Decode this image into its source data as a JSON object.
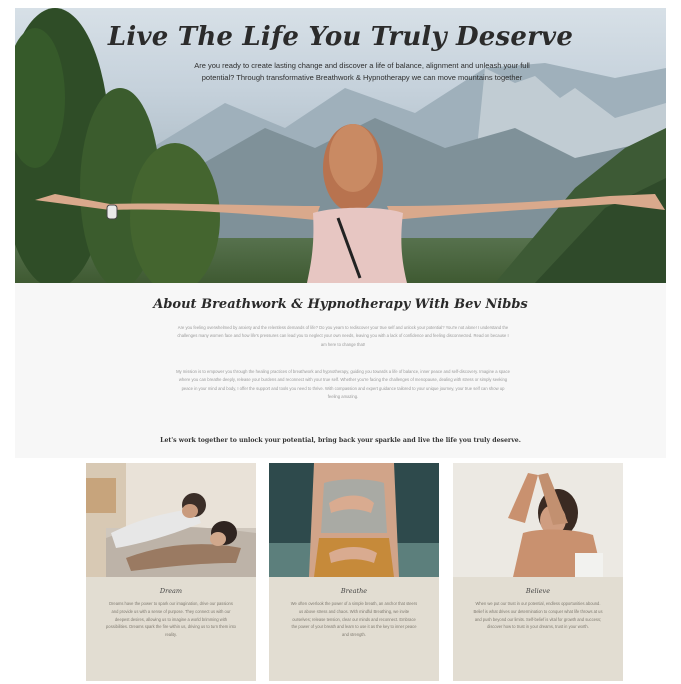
{
  "hero": {
    "title": "Live The Life You Truly Deserve",
    "subtitle": "Are you ready to create lasting change and discover a life of balance, alignment and unleash your full potential? Through transformative Breathwork & Hypnotherapy we can move mountains together"
  },
  "about": {
    "title": "About Breathwork & Hypnotherapy With Bev Nibbs",
    "paragraph1": "Are you feeling overwhelmed by anxiety and the relentless demands of life? Do you yearn to rediscover your true self and unlock your potential? You're not alone! I understand the challenges many women face and how life's pressures can lead you to neglect your own needs, leaving you with a lack of confidence and feeling disconnected. Read on because I am here to change that!",
    "paragraph2": "My mission is to empower you through the healing practices of breathwork and hypnotherapy, guiding you towards a life of balance, inner peace and self-discovery. Imagine a space where you can breathe deeply, release your burdens and reconnect with your true self. Whether you're facing the challenges of menopause, dealing with stress or simply seeking peace in your mind and body, I offer the support and tools you need to thrive. With compassion and expert guidance tailored to your unique journey, your true self can show up feeling amazing.",
    "cta": "Let's work together to unlock your potential, bring back your sparkle and live the life you truly deserve."
  },
  "cards": [
    {
      "title": "Dream",
      "text": "Dreams have the power to spark our imagination, drive our passions and provide us with a sense of purpose. They connect us with our deepest desires, allowing us to imagine a world brimming with possibilities. Dreams spark the fire within us, driving us to turn them into reality."
    },
    {
      "title": "Breathe",
      "text": "We often overlook the power of a simple breath, an anchor that steers us above stress and chaos. With mindful Breathing, we invite ourselves; release tension, clear our minds and reconnect. Embrace the power of your breath and learn to use it as the key to inner peace and strength."
    },
    {
      "title": "Believe",
      "text": "When we put our trust in our potential, endless opportunities abound. Belief is what drives our determination to conquer what life throws at us and push beyond our limits. Self-belief is vital for growth and success; discover how to trust in your dreams, trust in your worth."
    }
  ]
}
